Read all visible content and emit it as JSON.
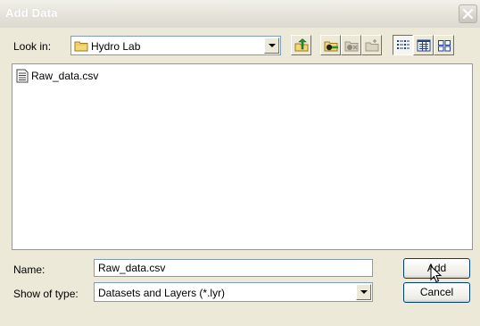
{
  "window": {
    "title": "Add Data"
  },
  "look_in": {
    "label": "Look in:",
    "value": "Hydro Lab",
    "icon": "folder-icon"
  },
  "toolbar": {
    "buttons": [
      {
        "name": "up-one-level-button",
        "icon": "up-folder-icon"
      },
      {
        "name": "connect-to-folder-button",
        "icon": "connect-folder-icon"
      },
      {
        "name": "disconnect-folder-button",
        "icon": "disconnect-folder-icon"
      },
      {
        "name": "new-folder-button",
        "icon": "new-folder-icon"
      },
      {
        "name": "list-view-button",
        "icon": "list-view-icon"
      },
      {
        "name": "details-view-button",
        "icon": "details-view-icon"
      },
      {
        "name": "thumbnails-view-button",
        "icon": "thumbnails-view-icon"
      }
    ]
  },
  "files": [
    {
      "name": "Raw_data.csv",
      "icon": "text-file-icon"
    }
  ],
  "name_field": {
    "label": "Name:",
    "value": "Raw_data.csv"
  },
  "type_field": {
    "label": "Show of type:",
    "value": "Datasets and Layers (*.lyr)"
  },
  "buttons": {
    "add": "Add",
    "cancel": "Cancel"
  },
  "colors": {
    "border_blue": "#7f9db9",
    "button_border": "#003c74",
    "face": "#ece9d8"
  }
}
